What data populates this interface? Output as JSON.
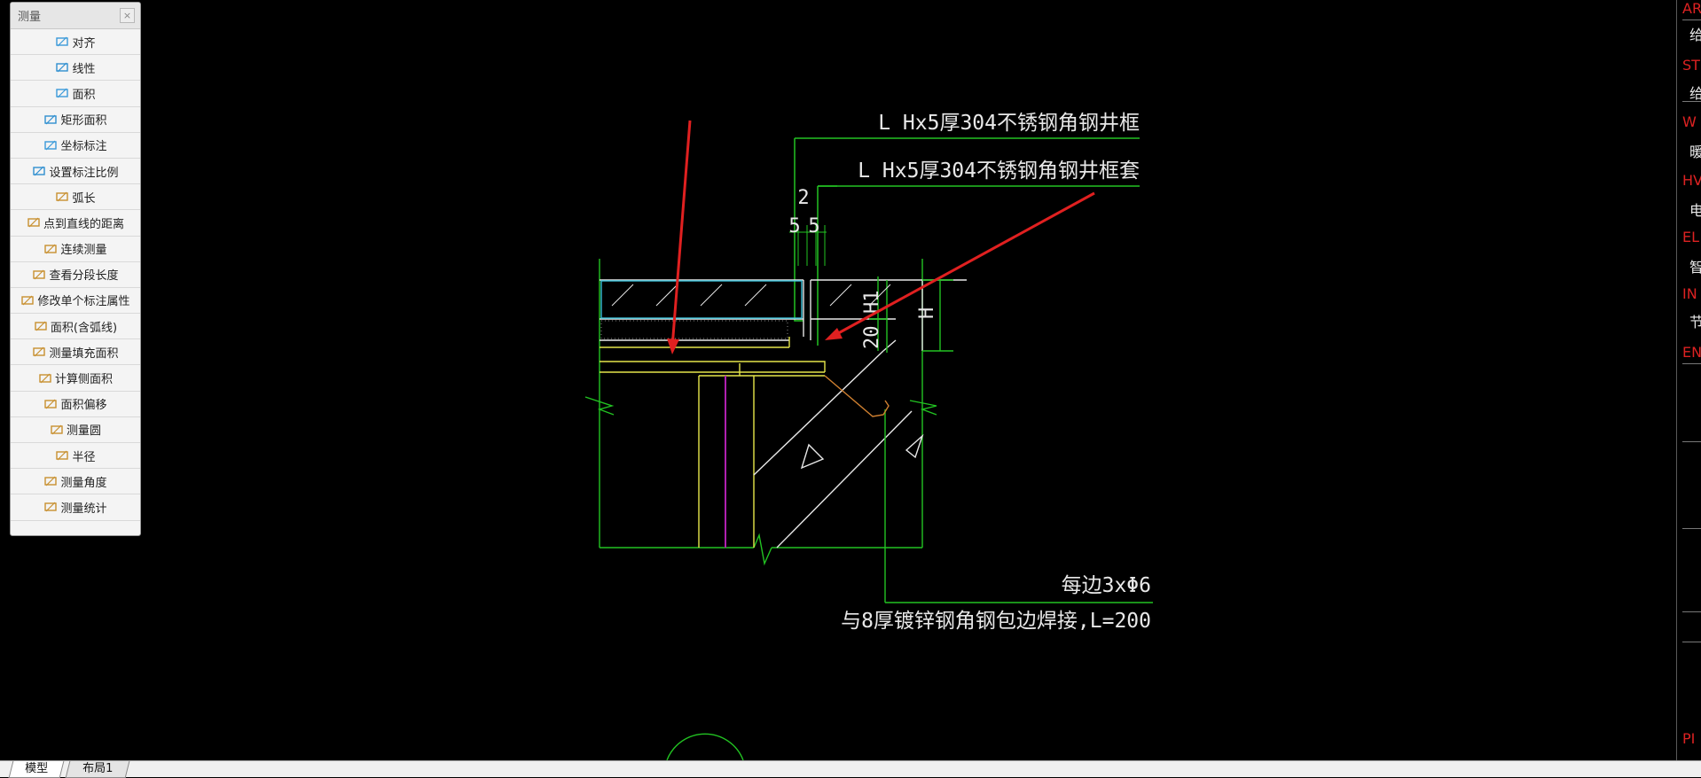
{
  "palette": {
    "title": "测量",
    "close_glyph": "×",
    "tools": [
      {
        "label": "对齐",
        "icon": "aligned-dim-icon"
      },
      {
        "label": "线性",
        "icon": "linear-dim-icon"
      },
      {
        "label": "面积",
        "icon": "area-icon"
      },
      {
        "label": "矩形面积",
        "icon": "rect-area-icon"
      },
      {
        "label": "坐标标注",
        "icon": "coordinate-icon"
      },
      {
        "label": "设置标注比例",
        "icon": "scale-icon"
      },
      {
        "label": "弧长",
        "icon": "arc-length-icon"
      },
      {
        "label": "点到直线的距离",
        "icon": "point-line-distance-icon"
      },
      {
        "label": "连续测量",
        "icon": "continuous-measure-icon"
      },
      {
        "label": "查看分段长度",
        "icon": "segment-length-icon"
      },
      {
        "label": "修改单个标注属性",
        "icon": "edit-dim-icon"
      },
      {
        "label": "面积(含弧线)",
        "icon": "arc-area-icon"
      },
      {
        "label": "测量填充面积",
        "icon": "hatch-area-icon"
      },
      {
        "label": "计算侧面积",
        "icon": "side-area-icon"
      },
      {
        "label": "面积偏移",
        "icon": "area-offset-icon"
      },
      {
        "label": "测量圆",
        "icon": "circle-icon"
      },
      {
        "label": "半径",
        "icon": "radius-icon"
      },
      {
        "label": "测量角度",
        "icon": "angle-icon"
      },
      {
        "label": "测量统计",
        "icon": "statistics-icon"
      }
    ]
  },
  "drawing": {
    "label_frame": "L Hx5厚304不锈钢角钢井框",
    "label_frame_sleeve": "L Hx5厚304不锈钢角钢井框套",
    "dim_2": "2",
    "dim_5a": "5",
    "dim_5b": "5",
    "dim_h1": "H1",
    "dim_20": "20",
    "dim_h": "H",
    "label_each_side": "每边3xΦ6",
    "label_weld": "与8厚镀锌钢角钢包边焊接,L=200",
    "colors": {
      "green": "#22c322",
      "yellow": "#e6e64a",
      "cyan": "#38c0d8",
      "magenta": "#b020b0",
      "orange": "#d08030",
      "white": "#e8e8e8",
      "arrow_red": "#e02020"
    }
  },
  "right_strip": {
    "items": [
      {
        "text": "AR",
        "color": "red"
      },
      {
        "text": "给",
        "color": "white"
      },
      {
        "text": "ST",
        "color": "red"
      },
      {
        "text": "给",
        "color": "white"
      },
      {
        "text": "W",
        "color": "red"
      },
      {
        "text": "暖",
        "color": "white"
      },
      {
        "text": "HV",
        "color": "red"
      },
      {
        "text": "电",
        "color": "white"
      },
      {
        "text": "EL",
        "color": "red"
      },
      {
        "text": "智",
        "color": "white"
      },
      {
        "text": "IN",
        "color": "red"
      },
      {
        "text": "节",
        "color": "white"
      },
      {
        "text": "EN",
        "color": "red"
      },
      {
        "text": "PI",
        "color": "red"
      }
    ]
  },
  "tabs": {
    "model": "模型",
    "layout1": "布局1"
  }
}
